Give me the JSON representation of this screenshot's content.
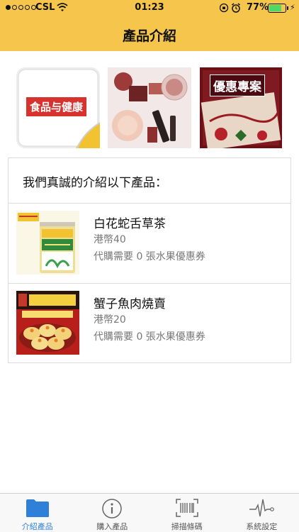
{
  "status_bar": {
    "carrier": "CSL",
    "time": "01:23",
    "battery_percent": "77%",
    "battery_level": 0.77,
    "icons": [
      "signal-dots",
      "wifi-icon",
      "orientation-lock-icon",
      "alarm-icon",
      "battery-icon",
      "charging-bolt-icon"
    ]
  },
  "navbar": {
    "title": "產品介紹"
  },
  "categories": [
    {
      "label": "食品与健康",
      "icon": "food-health-tile"
    },
    {
      "label": "",
      "icon": "cosmetics-tile"
    },
    {
      "label": "優惠專案",
      "icon": "promotion-tile"
    }
  ],
  "product_list": {
    "header": "我們真誠的介紹以下產品：",
    "items": [
      {
        "name": "白花蛇舌草茶",
        "price": "港幣40",
        "coupon_text": "代購需要 0 張水果優惠券"
      },
      {
        "name": "蟹子魚肉燒賣",
        "price": "港幣20",
        "coupon_text": "代購需要 0 張水果優惠券"
      }
    ]
  },
  "tab_bar": {
    "tabs": [
      {
        "label": "介紹產品",
        "icon": "folder-icon",
        "active": true
      },
      {
        "label": "購入產品",
        "icon": "info-icon",
        "active": false
      },
      {
        "label": "掃描條碼",
        "icon": "barcode-icon",
        "active": false
      },
      {
        "label": "系統設定",
        "icon": "pulse-icon",
        "active": false
      }
    ]
  },
  "colors": {
    "navbar_bg": "#f6c54b",
    "tab_active": "#2f80d9",
    "tab_inactive": "#555555",
    "battery_fill": "#4cd964"
  }
}
